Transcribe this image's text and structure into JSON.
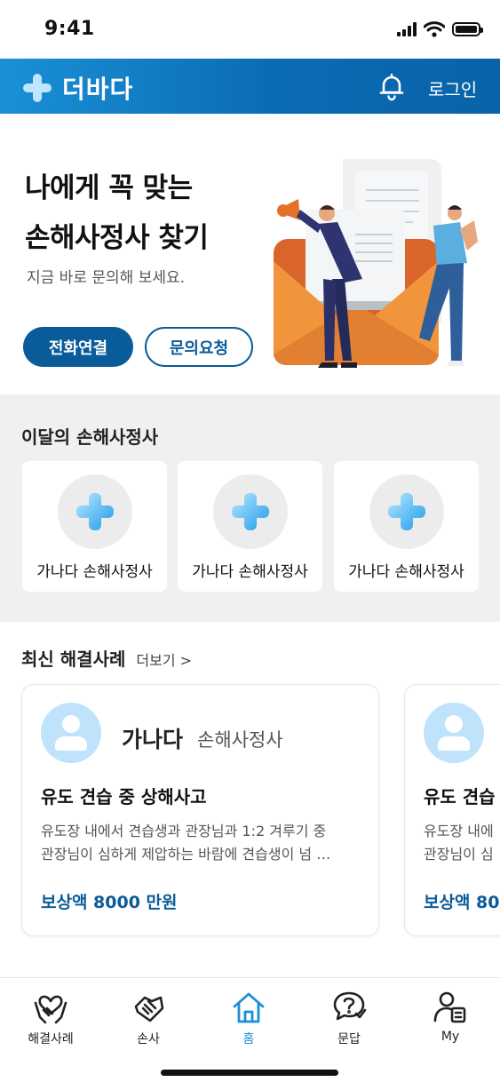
{
  "status_bar": {
    "time": "9:41"
  },
  "header": {
    "brand": "더바다",
    "login_label": "로그인"
  },
  "hero": {
    "title_line1": "나에게 꼭 맞는",
    "title_line2": "손해사정사 찾기",
    "subtitle": "지금 바로 문의해 보세요.",
    "call_button": "전화연결",
    "request_button": "문의요청"
  },
  "monthly": {
    "title": "이달의 손해사정사",
    "cards": [
      {
        "name": "가나다 손해사정사"
      },
      {
        "name": "가나다 손해사정사"
      },
      {
        "name": "가나다 손해사정사"
      }
    ]
  },
  "cases": {
    "title": "최신 해결사례",
    "more_label": "더보기 >",
    "items": [
      {
        "name": "가나다",
        "role": "손해사정사",
        "title": "유도 견습 중 상해사고",
        "desc_line1": "유도장 내에서 견습생과 관장님과 1:2 겨루기 중",
        "desc_line2": "관장님이 심하게 제압하는 바람에 견습생이 넘 …",
        "amount": "보상액 8000 만원"
      },
      {
        "name": "",
        "role": "",
        "title": "유도 견습",
        "desc_line1": "유도장 내에",
        "desc_line2": "관장님이 심",
        "amount": "보상액 80"
      }
    ]
  },
  "tabbar": {
    "items": [
      {
        "label": "해결사례",
        "icon": "handshake-heart-icon"
      },
      {
        "label": "손사",
        "icon": "handshake-icon"
      },
      {
        "label": "홈",
        "icon": "home-icon"
      },
      {
        "label": "문답",
        "icon": "question-chat-icon"
      },
      {
        "label": "My",
        "icon": "user-profile-icon"
      }
    ],
    "active_index": 2
  },
  "colors": {
    "primary": "#0a5c99",
    "header_start": "#1a90d6",
    "accent": "#1a8fd9",
    "section_bg": "#f0f0f0"
  }
}
